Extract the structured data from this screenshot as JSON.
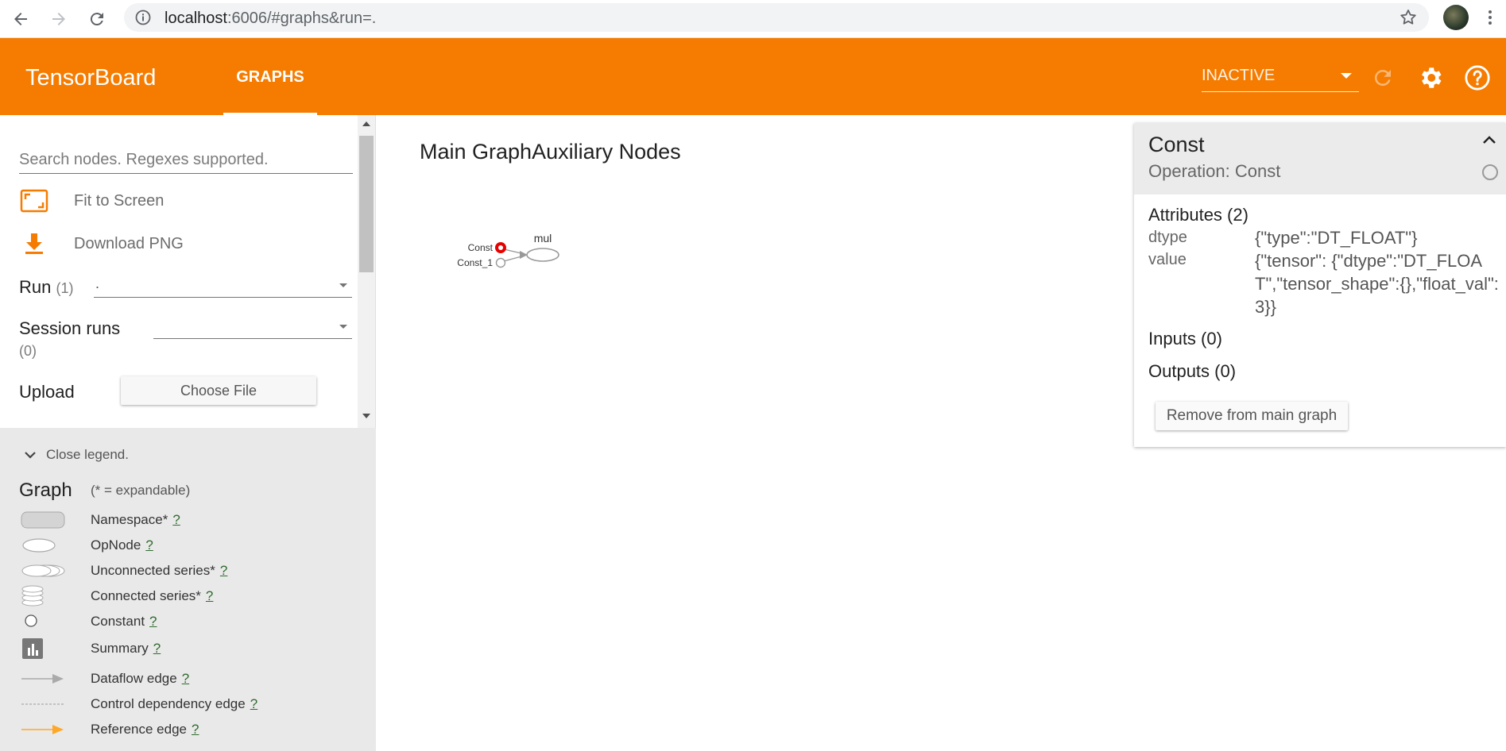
{
  "browser": {
    "url_host": "localhost",
    "url_rest": ":6006/#graphs&run=."
  },
  "header": {
    "brand": "TensorBoard",
    "tab_graphs": "GRAPHS",
    "run_status": "INACTIVE"
  },
  "sidebar": {
    "search_placeholder": "Search nodes. Regexes supported.",
    "fit_to_screen": "Fit to Screen",
    "download_png": "Download PNG",
    "run_label": "Run",
    "run_count": "(1)",
    "run_value": ".",
    "session_runs_label": "Session runs",
    "session_runs_count": "(0)",
    "upload_label": "Upload",
    "choose_file": "Choose File"
  },
  "legend": {
    "toggle": "Close legend.",
    "title": "Graph",
    "subtitle": "(* = expandable)",
    "help": "?",
    "items": [
      {
        "label": "Namespace*",
        "icon": "namespace-icon"
      },
      {
        "label": "OpNode",
        "icon": "opnode-icon"
      },
      {
        "label": "Unconnected series*",
        "icon": "unconnected-series-icon"
      },
      {
        "label": "Connected series*",
        "icon": "connected-series-icon"
      },
      {
        "label": "Constant",
        "icon": "constant-icon"
      },
      {
        "label": "Summary",
        "icon": "summary-icon"
      },
      {
        "label": "Dataflow edge",
        "icon": "dataflow-edge-icon"
      },
      {
        "label": "Control dependency edge",
        "icon": "control-edge-icon"
      },
      {
        "label": "Reference edge",
        "icon": "reference-edge-icon"
      }
    ]
  },
  "main": {
    "title": "Main GraphAuxiliary Nodes",
    "graph": {
      "nodes": {
        "const": "Const",
        "const1": "Const_1",
        "mul": "mul"
      }
    }
  },
  "info": {
    "name": "Const",
    "operation": "Operation: Const",
    "attributes_title": "Attributes (2)",
    "attributes": [
      {
        "key": "dtype",
        "value": "{\"type\":\"DT_FLOAT\"}"
      },
      {
        "key": "value",
        "value": "{\"tensor\": {\"dtype\":\"DT_FLOAT\",\"tensor_shape\":{},\"float_val\":3}}"
      }
    ],
    "inputs_title": "Inputs (0)",
    "outputs_title": "Outputs (0)",
    "remove_button": "Remove from main graph"
  },
  "colors": {
    "header_bg": "#f57c00",
    "selected_node": "#e60000",
    "legend_bg": "#e9e9e9"
  }
}
